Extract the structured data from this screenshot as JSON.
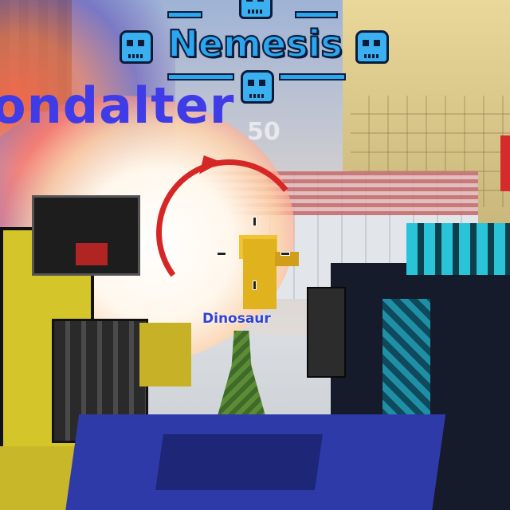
{
  "hud": {
    "title": "Nemesis",
    "killer_name": "ondalter",
    "score_ghost": "50",
    "icons": [
      "skull-icon"
    ]
  },
  "target": {
    "label": "Dinosaur"
  },
  "colors": {
    "title": "#2aa7ef",
    "title_outline": "#0c1b3a",
    "killer_name": "#3f3be6",
    "hit_indicator": "#d62727",
    "enemy_label": "#2f44d9"
  }
}
